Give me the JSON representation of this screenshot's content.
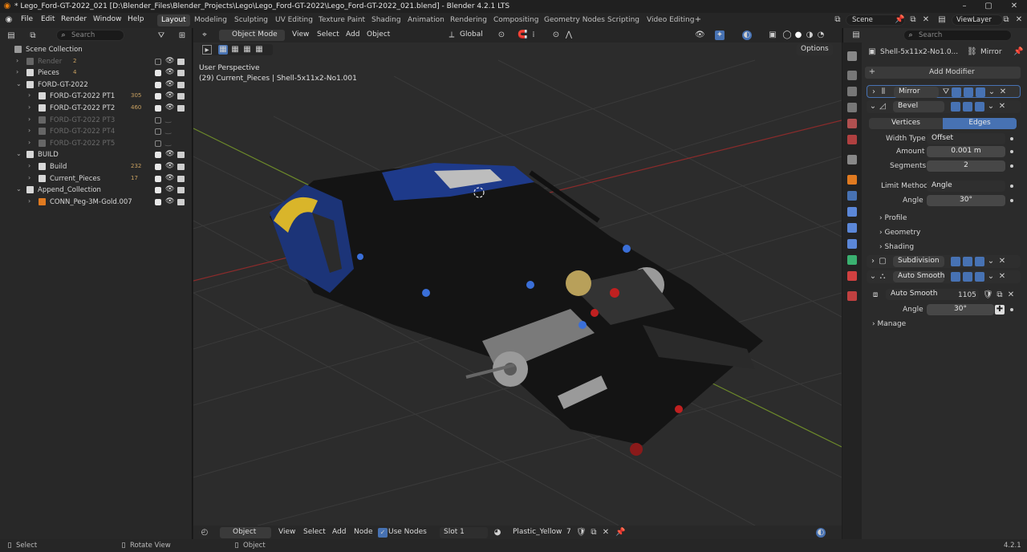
{
  "window": {
    "title": "* Lego_Ford-GT-2022_021 [D:\\Blender_Files\\Blender_Projects\\Lego\\Lego_Ford-GT-2022\\Lego_Ford-GT-2022_021.blend] - Blender 4.2.1 LTS"
  },
  "menu": [
    "File",
    "Edit",
    "Render",
    "Window",
    "Help"
  ],
  "workspaces": [
    "Layout",
    "Modeling",
    "Sculpting",
    "UV Editing",
    "Texture Paint",
    "Shading",
    "Animation",
    "Rendering",
    "Compositing",
    "Geometry Nodes",
    "Scripting",
    "Video Editing"
  ],
  "scene": {
    "name": "Scene",
    "view_layer": "ViewLayer"
  },
  "outliner": {
    "search_placeholder": "Search",
    "rows": [
      {
        "label": "Scene Collection",
        "indent": 0,
        "type": "scene",
        "vis": "none"
      },
      {
        "label": "Render",
        "indent": 1,
        "type": "collection",
        "dim": true,
        "badge": "2",
        "vis": "off"
      },
      {
        "label": "Pieces",
        "indent": 1,
        "type": "collection",
        "badge": "4",
        "vis": "on"
      },
      {
        "label": "FORD-GT-2022",
        "indent": 1,
        "type": "collection",
        "expanded": true,
        "vis": "on"
      },
      {
        "label": "FORD-GT-2022 PT1",
        "indent": 2,
        "type": "collection",
        "badge": "305",
        "vis": "on"
      },
      {
        "label": "FORD-GT-2022 PT2",
        "indent": 2,
        "type": "collection",
        "badge": "460",
        "vis": "on"
      },
      {
        "label": "FORD-GT-2022 PT3",
        "indent": 2,
        "type": "collection",
        "dim": true,
        "vis": "hidden"
      },
      {
        "label": "FORD-GT-2022 PT4",
        "indent": 2,
        "type": "collection",
        "dim": true,
        "vis": "hidden"
      },
      {
        "label": "FORD-GT-2022 PT5",
        "indent": 2,
        "type": "collection",
        "dim": true,
        "vis": "hidden"
      },
      {
        "label": "BUILD",
        "indent": 1,
        "type": "collection",
        "expanded": true,
        "vis": "on"
      },
      {
        "label": "Build",
        "indent": 2,
        "type": "collection",
        "badge": "232",
        "vis": "on"
      },
      {
        "label": "Current_Pieces",
        "indent": 2,
        "type": "collection",
        "badge": "17",
        "vis": "on"
      },
      {
        "label": "Append_Collection",
        "indent": 1,
        "type": "collection",
        "expanded": true,
        "vis": "on"
      },
      {
        "label": "CONN_Peg-3M-Gold.007",
        "indent": 2,
        "type": "object",
        "vis": "on"
      }
    ]
  },
  "viewport": {
    "mode": "Object Mode",
    "menus": [
      "View",
      "Select",
      "Add",
      "Object"
    ],
    "orientation": "Global",
    "options": "Options",
    "overlay_title": "User Perspective",
    "overlay_sub": "(29) Current_Pieces | Shell-5x11x2-No1.001"
  },
  "shader_bar": {
    "mode": "Object",
    "menus": [
      "View",
      "Select",
      "Add",
      "Node"
    ],
    "use_nodes": "Use Nodes",
    "slot": "Slot 1",
    "material": "Plastic_Yellow",
    "users": "7"
  },
  "status": {
    "left": "Select",
    "mid": "Rotate View",
    "right_obj": "Object",
    "version": "4.2.1"
  },
  "properties": {
    "search_placeholder": "Search",
    "object": "Shell-5x11x2-No1.0...",
    "modifier_ctx": "Mirror",
    "add_modifier": "Add Modifier",
    "modifiers": [
      {
        "name": "Mirror",
        "expanded": false
      },
      {
        "name": "Bevel",
        "expanded": true
      },
      {
        "name": "Subdivision",
        "expanded": false
      },
      {
        "name": "Auto Smooth",
        "expanded": true
      }
    ],
    "bevel": {
      "tabs": [
        "Vertices",
        "Edges"
      ],
      "width_type_label": "Width Type",
      "width_type": "Offset",
      "amount_label": "Amount",
      "amount": "0.001 m",
      "segments_label": "Segments",
      "segments": "2",
      "limit_label": "Limit Method",
      "limit": "Angle",
      "angle_label": "Angle",
      "angle": "30°",
      "subpanels": [
        "Profile",
        "Geometry",
        "Shading"
      ]
    },
    "auto_smooth": {
      "node": "Auto Smooth",
      "users": "1105",
      "angle_label": "Angle",
      "angle": "30°",
      "manage": "Manage"
    }
  },
  "colors": {
    "accent": "#4772b3",
    "bg": "#2c2c2c",
    "x_axis": "#8b2b2b",
    "y_axis": "#6d8a2a"
  }
}
